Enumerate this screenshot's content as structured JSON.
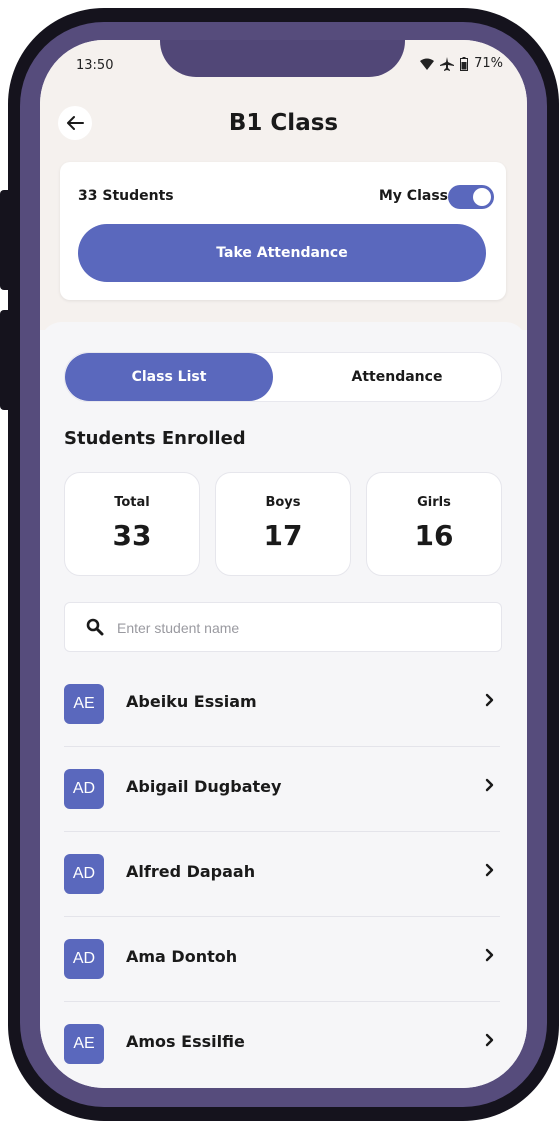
{
  "status_bar": {
    "time": "13:50",
    "battery": "71%"
  },
  "header": {
    "title": "B1 Class"
  },
  "class_card": {
    "student_count": "33 Students",
    "my_class_label": "My Class",
    "my_class_on": true,
    "take_attendance_label": "Take Attendance"
  },
  "tabs": {
    "active": "Class List",
    "inactive": "Attendance"
  },
  "enrollment": {
    "title": "Students Enrolled",
    "stats": [
      {
        "label": "Total",
        "value": "33"
      },
      {
        "label": "Boys",
        "value": "17"
      },
      {
        "label": "Girls",
        "value": "16"
      }
    ]
  },
  "search": {
    "placeholder": "Enter student name",
    "value": ""
  },
  "students": [
    {
      "initials": "AE",
      "name": "Abeiku Essiam"
    },
    {
      "initials": "AD",
      "name": "Abigail Dugbatey"
    },
    {
      "initials": "AD",
      "name": "Alfred Dapaah"
    },
    {
      "initials": "AD",
      "name": "Ama Dontoh"
    },
    {
      "initials": "AE",
      "name": "Amos Essilfie"
    }
  ],
  "colors": {
    "accent": "#5a68bd",
    "frame": "#15131d",
    "bezel": "#564c7c"
  }
}
